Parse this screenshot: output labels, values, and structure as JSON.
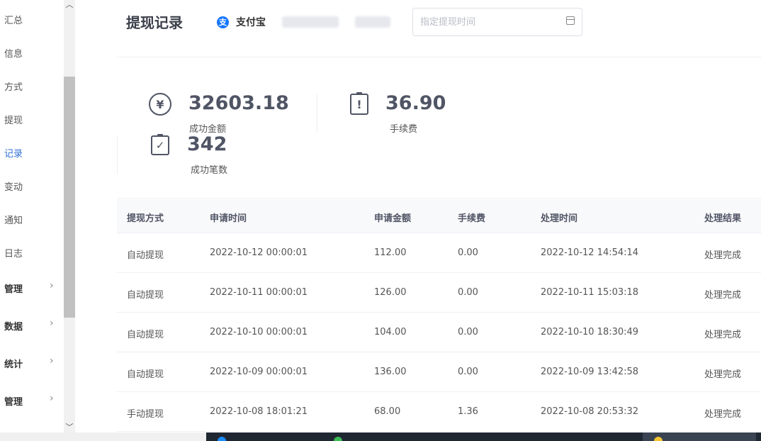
{
  "sidebar": {
    "items": [
      {
        "label": "汇总",
        "active": false
      },
      {
        "label": "信息",
        "active": false
      },
      {
        "label": "方式",
        "active": false
      },
      {
        "label": "提现",
        "active": false
      },
      {
        "label": "记录",
        "active": true
      },
      {
        "label": "变动",
        "active": false
      },
      {
        "label": "通知",
        "active": false
      },
      {
        "label": "日志",
        "active": false
      }
    ],
    "groups": [
      {
        "label": "管理",
        "chevron": "›"
      },
      {
        "label": "数据",
        "chevron": "›"
      },
      {
        "label": "统计",
        "chevron": "›"
      },
      {
        "label": "管理",
        "chevron": "›"
      }
    ]
  },
  "header": {
    "title": "提现记录",
    "account": {
      "icon_glyph": "支",
      "name": "支付宝"
    },
    "date_filter": {
      "placeholder": "指定提现时间",
      "value": ""
    }
  },
  "stats": {
    "success_amount": {
      "value": "32603.18",
      "label": "成功金额",
      "icon": "yuan-coin-icon",
      "glyph": "¥"
    },
    "fee": {
      "value": "36.90",
      "label": "手续费",
      "icon": "clipboard-alert-icon",
      "glyph": "!"
    },
    "success_count": {
      "value": "342",
      "label": "成功笔数",
      "icon": "clipboard-check-icon",
      "glyph": "✓"
    }
  },
  "table": {
    "headers": [
      "提现方式",
      "申请时间",
      "申请金额",
      "手续费",
      "处理时间",
      "处理结果"
    ],
    "rows": [
      [
        "自动提现",
        "2022-10-12 00:00:01",
        "112.00",
        "0.00",
        "2022-10-12 14:54:14",
        "处理完成"
      ],
      [
        "自动提现",
        "2022-10-11 00:00:01",
        "126.00",
        "0.00",
        "2022-10-11 15:03:18",
        "处理完成"
      ],
      [
        "自动提现",
        "2022-10-10 00:00:01",
        "104.00",
        "0.00",
        "2022-10-10 18:30:49",
        "处理完成"
      ],
      [
        "自动提现",
        "2022-10-09 00:00:01",
        "136.00",
        "0.00",
        "2022-10-09 13:42:58",
        "处理完成"
      ],
      [
        "手动提现",
        "2022-10-08 18:01:21",
        "68.00",
        "1.36",
        "2022-10-08 20:53:32",
        "处理完成"
      ]
    ]
  },
  "colors": {
    "accent": "#2f6fd6",
    "alipay": "#1677ff",
    "stat_text": "#505565"
  }
}
